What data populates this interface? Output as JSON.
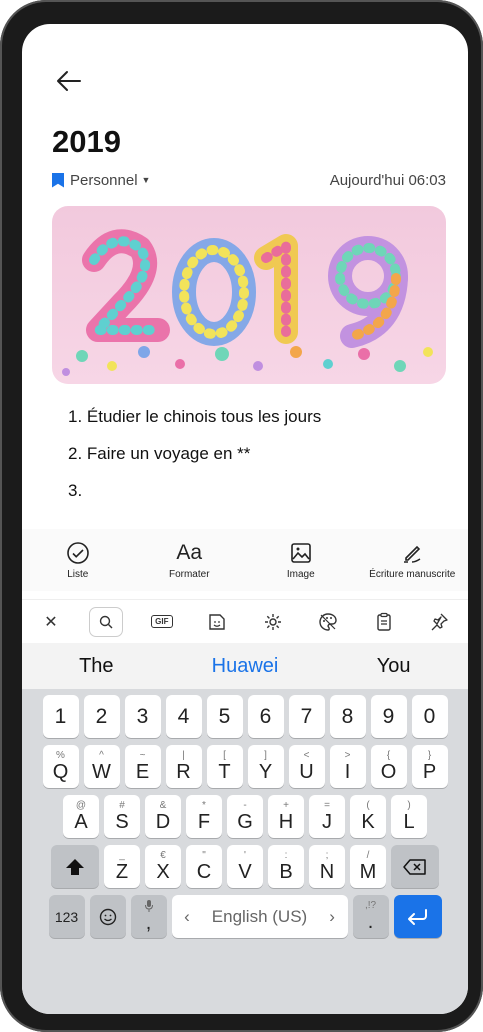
{
  "note": {
    "title": "2019",
    "folder": "Personnel",
    "timestamp": "Aujourd'hui 06:03",
    "items": [
      "1. Étudier le chinois tous les jours",
      "2. Faire un voyage en **",
      "3."
    ]
  },
  "toolbar": {
    "list": "Liste",
    "format": "Formater",
    "format_glyph": "Aa",
    "image": "Image",
    "handwriting": "Écriture manuscrite"
  },
  "keyboard_bar": {
    "gif": "GIF"
  },
  "suggestions": [
    "The",
    "Huawei",
    "You"
  ],
  "keyboard": {
    "numbers": [
      "1",
      "2",
      "3",
      "4",
      "5",
      "6",
      "7",
      "8",
      "9",
      "0"
    ],
    "row1": [
      {
        "sub": "%",
        "main": "Q"
      },
      {
        "sub": "^",
        "main": "W"
      },
      {
        "sub": "~",
        "main": "E"
      },
      {
        "sub": "|",
        "main": "R"
      },
      {
        "sub": "[",
        "main": "T"
      },
      {
        "sub": "]",
        "main": "Y"
      },
      {
        "sub": "<",
        "main": "U"
      },
      {
        "sub": ">",
        "main": "I"
      },
      {
        "sub": "{",
        "main": "O"
      },
      {
        "sub": "}",
        "main": "P"
      }
    ],
    "row2": [
      {
        "sub": "@",
        "main": "A"
      },
      {
        "sub": "#",
        "main": "S"
      },
      {
        "sub": "&",
        "main": "D"
      },
      {
        "sub": "*",
        "main": "F"
      },
      {
        "sub": "-",
        "main": "G"
      },
      {
        "sub": "+",
        "main": "H"
      },
      {
        "sub": "=",
        "main": "J"
      },
      {
        "sub": "(",
        "main": "K"
      },
      {
        "sub": ")",
        "main": "L"
      }
    ],
    "row3": [
      {
        "sub": "_",
        "main": "Z"
      },
      {
        "sub": "€",
        "main": "X"
      },
      {
        "sub": "\"",
        "main": "C"
      },
      {
        "sub": "'",
        "main": "V"
      },
      {
        "sub": ":",
        "main": "B"
      },
      {
        "sub": ";",
        "main": "N"
      },
      {
        "sub": "/",
        "main": "M"
      }
    ],
    "mode_key": "123",
    "comma": ",",
    "space_label": "English (US)",
    "period": ".",
    "period_sub": ",!?"
  },
  "colors": {
    "accent": "#1a73e8"
  }
}
